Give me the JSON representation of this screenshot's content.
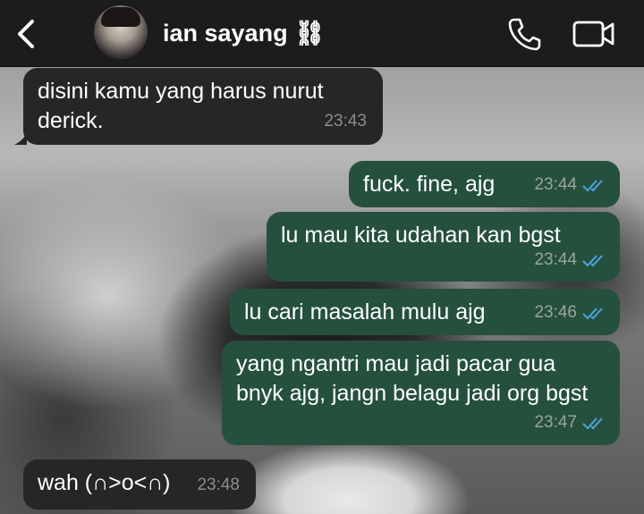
{
  "header": {
    "contact_name": "ian sayang ⛓",
    "icons": {
      "back": "chevron-left-icon",
      "call": "phone-icon",
      "video": "video-camera-icon"
    },
    "colors": {
      "bar": "#1c1c1c",
      "text": "#ffffff"
    }
  },
  "messages": [
    {
      "direction": "in",
      "text": "disini kamu yang harus nurut derick.",
      "time": "23:43"
    },
    {
      "direction": "out",
      "text": "fuck. fine, ajg",
      "time": "23:44",
      "status": "read"
    },
    {
      "direction": "out",
      "text": "lu mau kita udahan kan bgst",
      "time": "23:44",
      "status": "read"
    },
    {
      "direction": "out",
      "text": "lu cari masalah mulu ajg",
      "time": "23:46",
      "status": "read"
    },
    {
      "direction": "out",
      "text": "yang ngantri mau jadi pacar gua bnyk ajg, jangn belagu jadi org bgst",
      "time": "23:47",
      "status": "read"
    },
    {
      "direction": "in",
      "text": "wah (∩>o<∩)",
      "time": "23:48"
    }
  ],
  "colors": {
    "incoming_bubble": "#262626",
    "outgoing_bubble": "#25503e",
    "read_tick": "#4aa3df"
  }
}
